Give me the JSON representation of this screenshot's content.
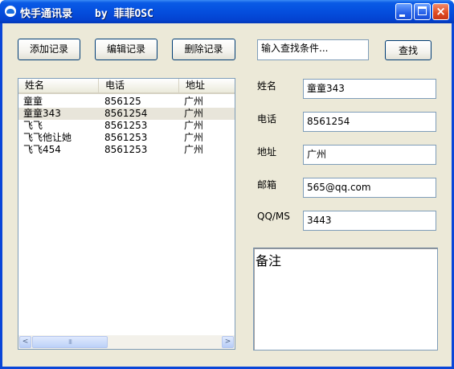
{
  "window": {
    "title": "快手通讯录",
    "author": "by 菲菲OSC",
    "controls": {
      "minimize": "minimize",
      "maximize": "maximize",
      "close": "×"
    }
  },
  "toolbar": {
    "add_label": "添加记录",
    "edit_label": "编辑记录",
    "delete_label": "删除记录",
    "search_value": "输入查找条件...",
    "search_button": "查找"
  },
  "list": {
    "columns": [
      "姓名",
      "电话",
      "地址"
    ],
    "rows": [
      {
        "name": "童童",
        "phone": "856125",
        "address": "广州"
      },
      {
        "name": "童童343",
        "phone": "8561254",
        "address": "广州"
      },
      {
        "name": "飞飞",
        "phone": "8561253",
        "address": "广州"
      },
      {
        "name": "飞飞他让她",
        "phone": "8561253",
        "address": "广州"
      },
      {
        "name": "飞飞454",
        "phone": "8561253",
        "address": "广州"
      }
    ],
    "selected_row": 1,
    "scroll": {
      "left_arrow": "<",
      "right_arrow": ">",
      "thumb_grip": "III"
    }
  },
  "form": {
    "name_label": "姓名",
    "name_value": "童童343",
    "phone_label": "电话",
    "phone_value": "8561254",
    "address_label": "地址",
    "address_value": "广州",
    "email_label": "邮箱",
    "email_value": "565@qq.com",
    "qq_label": "QQ/MS",
    "qq_value": "3443",
    "notes_value": "备注"
  }
}
